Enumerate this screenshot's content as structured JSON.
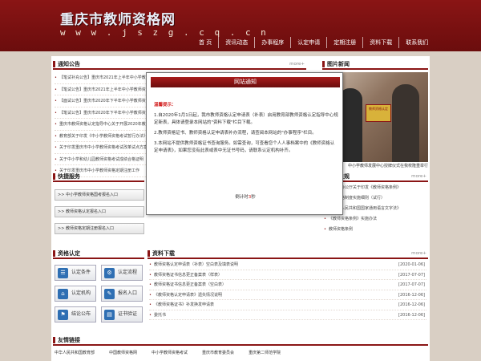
{
  "header": {
    "title": "重庆市教师资格网",
    "url": "w w w . j s z g . c q . c n"
  },
  "nav": [
    "首 页",
    "资讯动态",
    "办事程序",
    "认定申请",
    "定期注册",
    "资料下载",
    "联系我们"
  ],
  "notice": {
    "title": "通知公告",
    "more": "more+",
    "items": [
      "【笔试补充公告】重庆市2021年上半年中小学教师资格考试（笔试）",
      "【笔试公告】重庆市2021年上半年中小学教师资格考试（笔试）",
      "【面试公告】重庆市2020年下半年中小学教师资格考试（面试）",
      "【笔试公告】重庆市2020年下半年中小学教师资格考试（笔试）",
      "重庆市教师资格认定指导中心关于开展2020年教师资格认定",
      "教育部关于印发《中小学教师资格考试暂行办法》",
      "关于印发重庆市中小学教师资格考试改革试点方案",
      "关于中小学和幼儿园教师资格考试成绩合格证明",
      "关于印发重庆市中小学教师资格定期注册工作"
    ]
  },
  "photo_news": {
    "title": "图片新闻",
    "plaque": "教师资格认定",
    "caption": "中小学教师发展中心授牌仪式在我校隆重举行"
  },
  "quick": {
    "title": "快捷服务",
    "items": [
      ">> 中小学教师资格国考报名入口",
      ">> 教师资格认定报名入口",
      ">> 教师资格定期注册报名入口"
    ]
  },
  "regulation": {
    "title": "政策法规",
    "more": "more+",
    "items": [
      "教育部办公厅关于印发《教师资格条例》",
      "教师资格制度实施细则（试行）",
      "《中华人民共和国国家通用语言文字法》",
      "《教师资格条例》实施办法",
      "教师资格条例",
      "教师资格条例"
    ]
  },
  "certification": {
    "title": "资格认定",
    "buttons": [
      "认定条件",
      "认定流程",
      "认定机构",
      "报名入口",
      "结论公布",
      "证书验证"
    ]
  },
  "download": {
    "title": "资料下载",
    "more": "more+",
    "items": [
      {
        "name": "教师资格认定申请表（补表）空白表及填表说明",
        "date": "[2020-01-06]"
      },
      {
        "name": "教师资格证书信息更正备案表（样表）",
        "date": "[2017-07-07]"
      },
      {
        "name": "教师资格证书信息更正备案表（空白表）",
        "date": "[2017-07-07]"
      },
      {
        "name": "《教师资格认定申请表》遗失情况说明",
        "date": "[2016-12-06]"
      },
      {
        "name": "《教师资格证书》补发换发申请表",
        "date": "[2016-12-06]"
      },
      {
        "name": "委托书",
        "date": "[2016-12-06]"
      }
    ]
  },
  "links": {
    "title": "友情链接",
    "items": [
      "中华人民共和国教育部",
      "中国教师资格网",
      "中小学教师资格考试",
      "重庆市教育委员会",
      "重庆第二师范学院"
    ]
  },
  "modal": {
    "title": "网站通知",
    "tip": "温馨提示：",
    "p1": "1.自2020年1月1日起，我市教师资格认定申请表（补表）启用教育部教师资格认定指导中心规定新表，具体请登录本网站的\"资料下载\"栏目下载。",
    "p2": "2.教师资格证书、教师资格认定申请表补办流程，请查阅本网站的\"办事程序\"栏目。",
    "p3": "3.本网站不提供教师资格证书查询服务。如需查询，可查看您个人人事档案中的《教师资格认定申请表》，如果您没有此表或表中无证书号码，请联系认定机构补齐。",
    "count_prefix": "倒计时",
    "count_num": "3",
    "count_suffix": "秒"
  },
  "colors": {
    "brand": "#8a1515",
    "accent_red": "#d21f1f",
    "icon_blue": "#2f6fb3"
  }
}
